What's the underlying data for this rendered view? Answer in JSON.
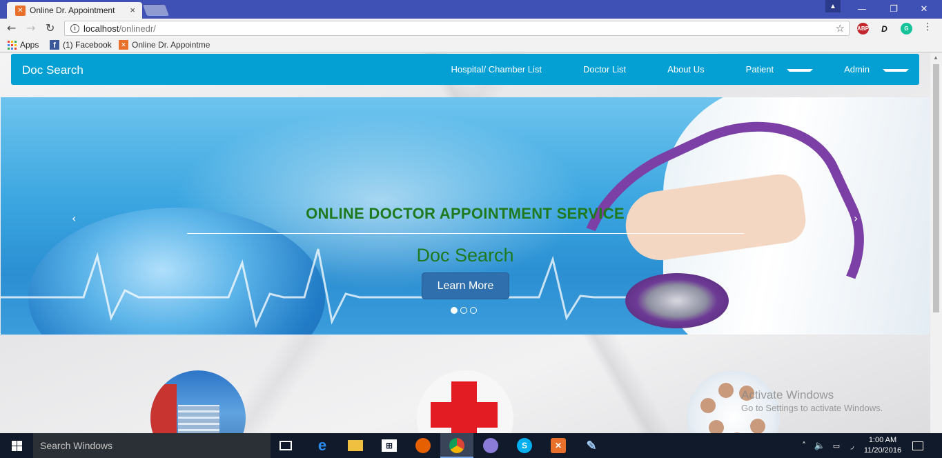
{
  "browser": {
    "tab_title": "Online Dr. Appointment",
    "tab_close": "×",
    "url_host": "localhost",
    "url_path": "/onlinedr/",
    "bookmarks": [
      {
        "label": "Apps",
        "icon": "apps-grid-icon"
      },
      {
        "label": "(1) Facebook",
        "icon": "facebook-icon"
      },
      {
        "label": "Online Dr. Appointme",
        "icon": "xampp-icon"
      }
    ],
    "extensions": [
      "ABP",
      "D",
      "G"
    ],
    "window_controls": {
      "minimize": "—",
      "maximize": "❐",
      "close": "✕"
    }
  },
  "navbar": {
    "brand": "Doc Search",
    "links": [
      {
        "label": "Hospital/ Chamber List",
        "dropdown": false
      },
      {
        "label": "Doctor List",
        "dropdown": false
      },
      {
        "label": "About Us",
        "dropdown": false
      },
      {
        "label": "Patient",
        "dropdown": true
      },
      {
        "label": "Admin",
        "dropdown": true
      }
    ],
    "color": "#04a0d4"
  },
  "carousel": {
    "title": "ONLINE DOCTOR APPOINTMENT SERVICE",
    "subtitle": "Doc Search",
    "button": "Learn More",
    "prev": "‹",
    "next": "›",
    "active_slide": 1,
    "slide_count": 3
  },
  "features": [
    {
      "icon": "hospital-building-icon"
    },
    {
      "icon": "red-cross-icon"
    },
    {
      "icon": "doctors-group-icon"
    }
  ],
  "watermark": {
    "line1": "Activate Windows",
    "line2": "Go to Settings to activate Windows."
  },
  "taskbar": {
    "search_placeholder": "Search Windows",
    "time": "1:00 AM",
    "date": "11/20/2016"
  }
}
